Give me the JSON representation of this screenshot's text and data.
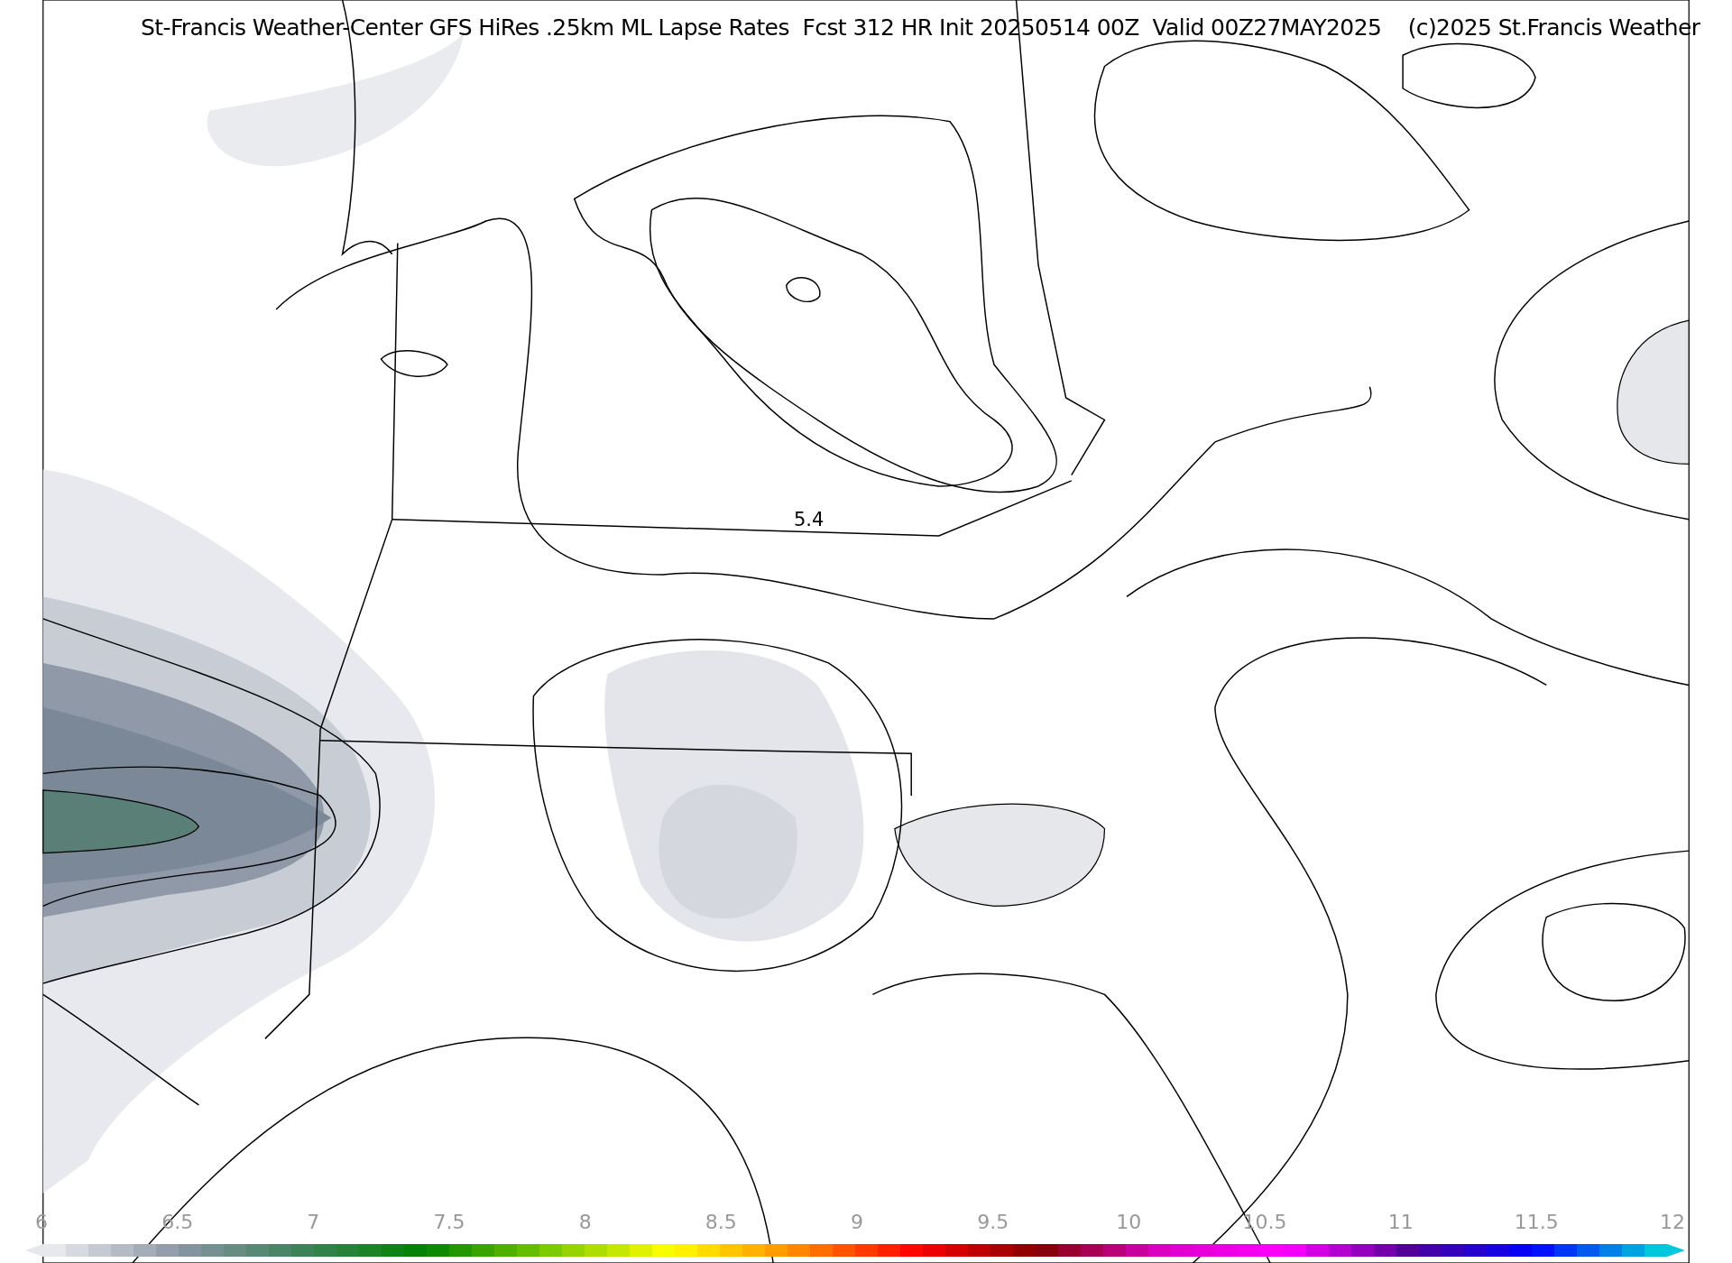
{
  "title": "St-Francis Weather-Center GFS HiRes .25km ML Lapse Rates  Fcst 312 HR Init 20250514 00Z  Valid 00Z27MAY2025    (c)2025 St.Francis Weather",
  "map": {
    "contour_labels": [
      "5.4"
    ]
  },
  "colorbar": {
    "ticks": [
      "6",
      "6.5",
      "7",
      "7.5",
      "8",
      "8.5",
      "9",
      "9.5",
      "10",
      "10.5",
      "11",
      "11.5",
      "12"
    ]
  }
}
